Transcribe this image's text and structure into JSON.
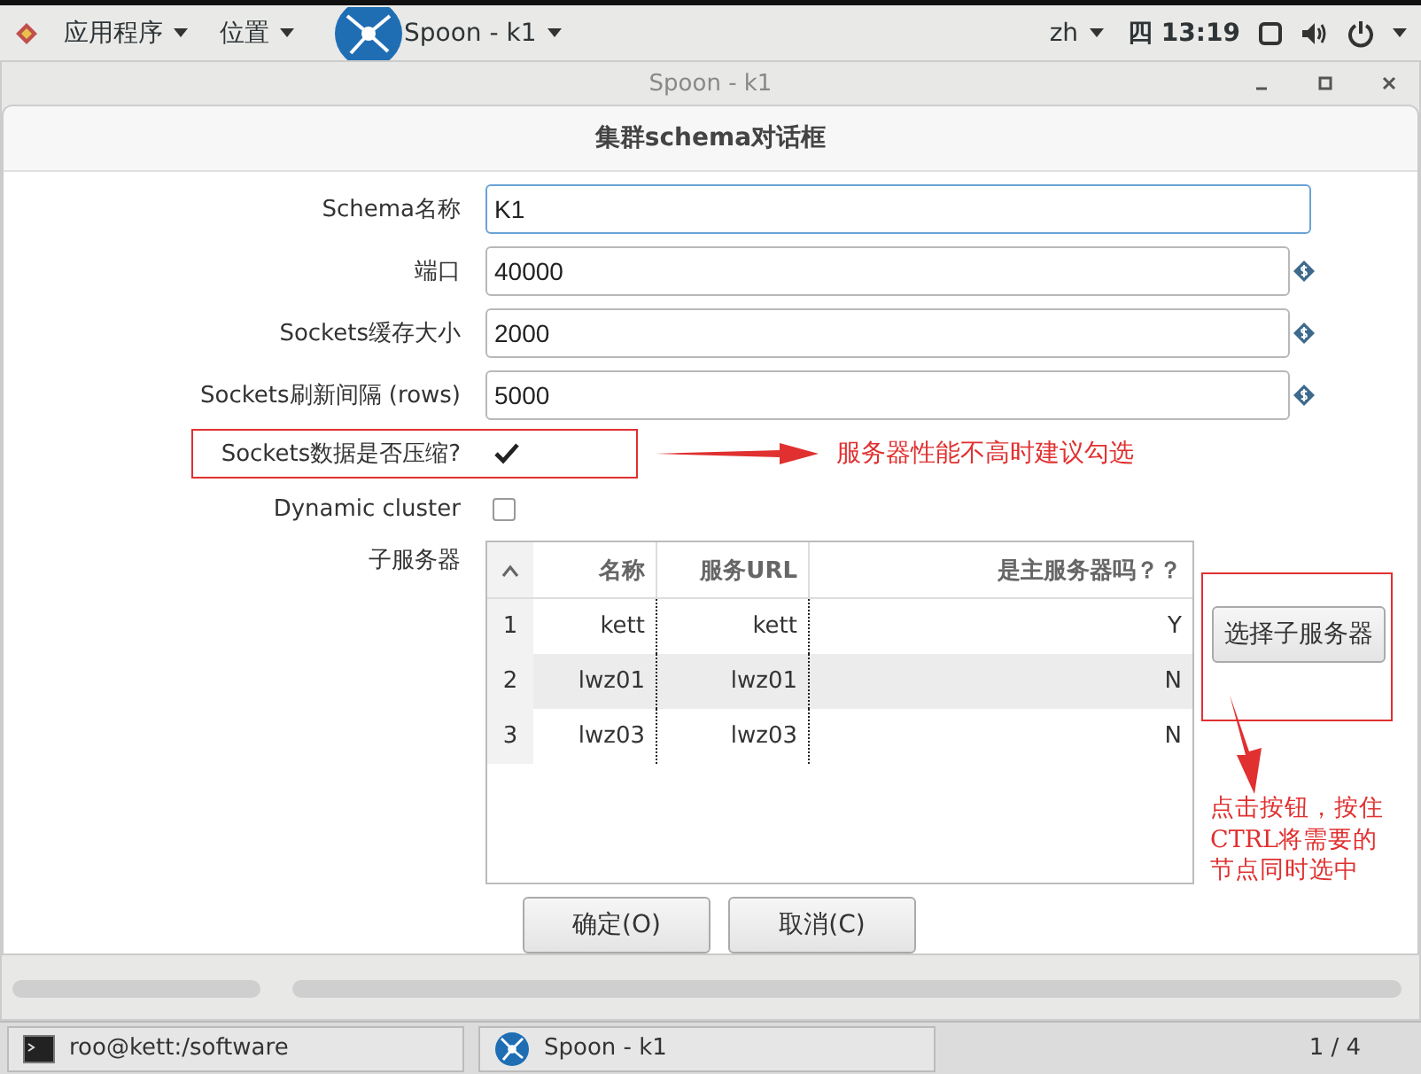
{
  "top_bar": {
    "apps_menu": "应用程序",
    "places_menu": "位置",
    "active_app": "Spoon - k1",
    "input_method": "zh",
    "clock": "四 13:19"
  },
  "window": {
    "title": "Spoon - k1"
  },
  "dialog": {
    "title": "集群schema对话框",
    "fields": [
      {
        "label": "Schema名称",
        "value": "K1",
        "kind": "text",
        "focused": true
      },
      {
        "label": "端口",
        "value": "40000",
        "kind": "variable",
        "focused": false
      },
      {
        "label": "Sockets缓存大小",
        "value": "2000",
        "kind": "variable",
        "focused": false
      },
      {
        "label": "Sockets刷新间隔 (rows)",
        "value": "5000",
        "kind": "variable",
        "focused": false
      }
    ],
    "checks": [
      {
        "label": "Sockets数据是否压缩?",
        "checked": true,
        "highlighted": true
      },
      {
        "label": "Dynamic cluster",
        "checked": false,
        "highlighted": false
      }
    ],
    "sub_servers": {
      "label": "子服务器",
      "columns": [
        "名称",
        "服务URL",
        "是主服务器吗？？"
      ],
      "rows": [
        {
          "index": "1",
          "name": "kett",
          "url": "kett",
          "master": "Y",
          "selected": false
        },
        {
          "index": "2",
          "name": "lwz01",
          "url": "lwz01",
          "master": "N",
          "selected": true
        },
        {
          "index": "3",
          "name": "lwz03",
          "url": "lwz03",
          "master": "N",
          "selected": false
        }
      ]
    },
    "select_button": "选择子服务器",
    "buttons": [
      "确定(O)",
      "取消(C)"
    ]
  },
  "annotations": {
    "compress_note": "服务器性能不高时建议勾选",
    "select_note": "点击按钮，按住CTRL将需要的节点同时选中"
  },
  "taskbar": {
    "items": [
      {
        "label": "roo@kett:/software",
        "kind": "terminal"
      },
      {
        "label": "Spoon - k1",
        "kind": "spoon"
      }
    ],
    "pager": "1 / 4"
  }
}
